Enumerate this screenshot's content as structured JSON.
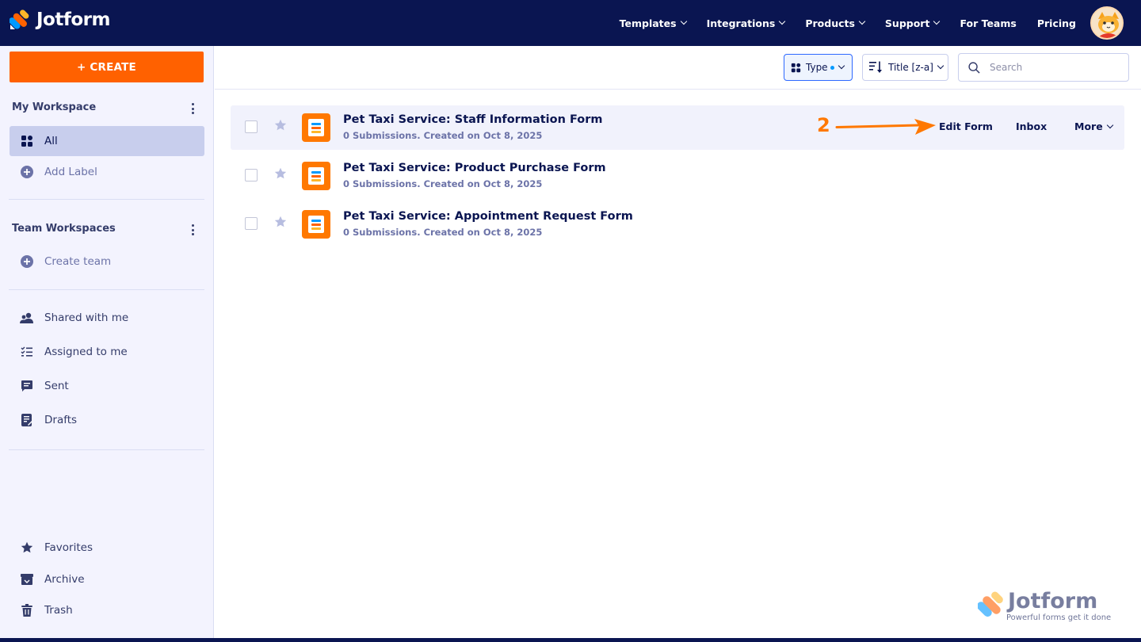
{
  "header": {
    "brand": "Jotform",
    "nav": [
      {
        "label": "Templates",
        "has_dropdown": true
      },
      {
        "label": "Integrations",
        "has_dropdown": true
      },
      {
        "label": "Products",
        "has_dropdown": true
      },
      {
        "label": "Support",
        "has_dropdown": true
      },
      {
        "label": "For Teams",
        "has_dropdown": false
      },
      {
        "label": "Pricing",
        "has_dropdown": false
      }
    ],
    "avatar_icon": "user-avatar-icon"
  },
  "sidebar": {
    "create_label": "+ CREATE",
    "my_workspace_title": "My Workspace",
    "all_label": "All",
    "add_label": "Add Label",
    "team_workspaces_title": "Team Workspaces",
    "create_team": "Create team",
    "shared_with_me": "Shared with me",
    "assigned_to_me": "Assigned to me",
    "sent": "Sent",
    "drafts": "Drafts",
    "favorites": "Favorites",
    "archive": "Archive",
    "trash": "Trash"
  },
  "toolbar": {
    "type_label": "Type",
    "sort_label": "Title [z-a]",
    "search_placeholder": "Search"
  },
  "forms": [
    {
      "title": "Pet Taxi Service: Staff Information Form",
      "meta": "0 Submissions. Created on Oct 8, 2025"
    },
    {
      "title": "Pet Taxi Service: Product Purchase Form",
      "meta": "0 Submissions. Created on Oct 8, 2025"
    },
    {
      "title": "Pet Taxi Service: Appointment Request Form",
      "meta": "0 Submissions. Created on Oct 8, 2025"
    }
  ],
  "row_actions": {
    "edit_form": "Edit Form",
    "inbox": "Inbox",
    "more": "More"
  },
  "annotation": {
    "step_number": "2"
  },
  "watermark": {
    "brand": "Jotform",
    "tagline": "Powerful forms get it done"
  },
  "colors": {
    "navy": "#0a1551",
    "orange": "#ff6100",
    "sidebar_bg": "#f3f3fe",
    "active_bg": "#c8ceed"
  }
}
